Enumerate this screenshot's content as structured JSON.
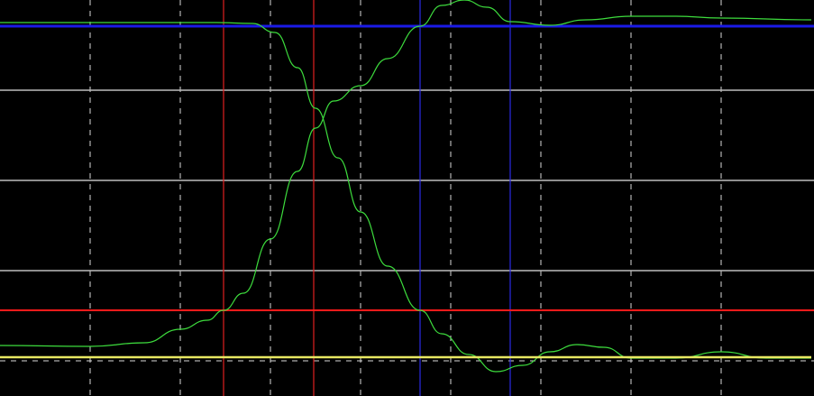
{
  "chart_data": {
    "type": "line",
    "grid": true,
    "x_range": [
      0,
      9
    ],
    "y_range": [
      -4.38,
      0
    ],
    "grid_lines": {
      "vertical_dashed": [
        1,
        2,
        3,
        4,
        5,
        6,
        7,
        8
      ],
      "horizontal_dashed": [
        -1,
        -3,
        -4
      ],
      "horizontal_solid_gray": [
        -1,
        -2,
        -3
      ]
    },
    "cursors": {
      "vertical_red": [
        2.48,
        3.48
      ],
      "vertical_blue": [
        4.66,
        5.66
      ],
      "horizontal_red": [
        -3.44
      ],
      "horizontal_blue": [
        -0.29
      ]
    },
    "series": [
      {
        "color": "#3ddc3d",
        "x": [
          0,
          1,
          2,
          2.4,
          2.8,
          3.05,
          3.3,
          3.5,
          3.75,
          4.0,
          4.3,
          4.66,
          4.9,
          5.2,
          5.5,
          5.8,
          6.1,
          6.4,
          6.7,
          7.0,
          7.5,
          8.0,
          8.5,
          9.0
        ],
        "values": [
          -0.25,
          -0.25,
          -0.25,
          -0.25,
          -0.26,
          -0.36,
          -0.75,
          -1.2,
          -1.75,
          -2.35,
          -2.95,
          -3.44,
          -3.7,
          -3.93,
          -4.12,
          -4.05,
          -3.9,
          -3.82,
          -3.85,
          -3.97,
          -3.97,
          -3.9,
          -3.97,
          -3.97
        ]
      },
      {
        "color": "#3ddc3d",
        "x": [
          0,
          1,
          1.6,
          2.0,
          2.3,
          2.48,
          2.7,
          3.0,
          3.3,
          3.5,
          3.7,
          4.0,
          4.3,
          4.66,
          4.9,
          5.15,
          5.4,
          5.66,
          6.1,
          6.5,
          7.0,
          7.5,
          8.0,
          9.0
        ],
        "values": [
          -3.83,
          -3.84,
          -3.8,
          -3.65,
          -3.55,
          -3.44,
          -3.25,
          -2.65,
          -1.9,
          -1.42,
          -1.12,
          -0.95,
          -0.65,
          -0.29,
          -0.06,
          0,
          -0.08,
          -0.24,
          -0.28,
          -0.22,
          -0.18,
          -0.18,
          -0.2,
          -0.22
        ]
      },
      {
        "color": "#e8e862",
        "x": [
          0,
          9
        ],
        "values": [
          -3.96,
          -3.96
        ]
      }
    ]
  }
}
